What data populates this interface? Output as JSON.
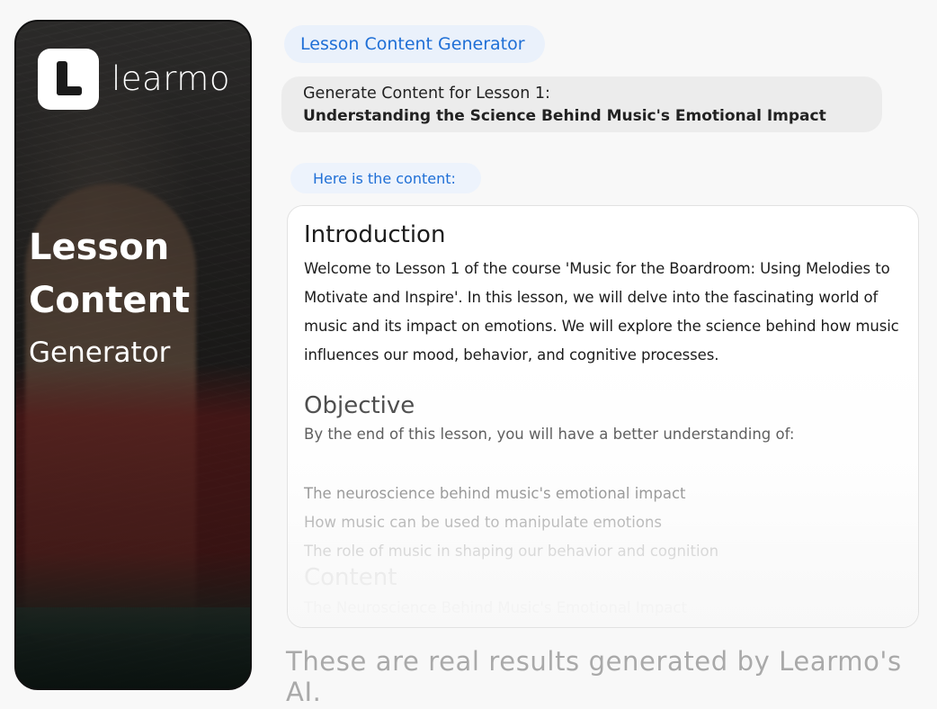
{
  "promo": {
    "logo_text": "learmo",
    "title_line1": "Lesson",
    "title_line2": "Content",
    "subtitle": "Generator"
  },
  "chat": {
    "title_chip": "Lesson Content Generator",
    "prompt_line1": "Generate Content for Lesson 1:",
    "prompt_line2": "Understanding the Science Behind Music's Emotional Impact",
    "reply_chip": "Here is the content:"
  },
  "content": {
    "intro_heading": "Introduction",
    "intro_text": "Welcome to Lesson 1 of the course 'Music for the Boardroom: Using Melodies to Motivate and Inspire'. In this lesson, we will delve into the fascinating world of music and its impact on emotions. We will explore the science behind how music influences our mood, behavior, and cognitive processes.",
    "objective_heading": "Objective",
    "objective_text": "By the end of this lesson, you will have a better understanding of:",
    "objectives": [
      "The neuroscience behind music's emotional impact",
      "How music can be used to manipulate emotions",
      "The role of music in shaping our behavior and cognition"
    ],
    "content_heading": "Content",
    "content_sub": "The Neuroscience Behind Music's Emotional Impact"
  },
  "footer": {
    "note": "These are real results generated by Learmo's AI."
  },
  "colors": {
    "accent": "#1f6fd6",
    "chip_bg": "#eaf1fb",
    "prompt_bg": "#ececec"
  }
}
